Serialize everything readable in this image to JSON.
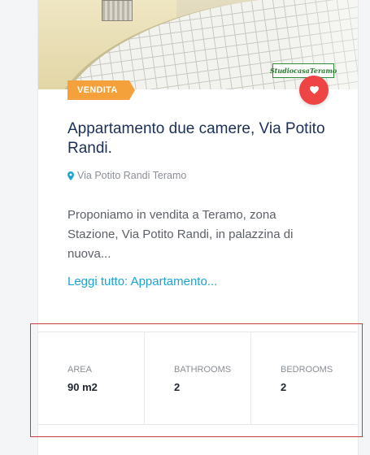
{
  "listing": {
    "status_badge": "VENDITA",
    "watermark_text": "StudiocasaTeramo",
    "title": "Appartamento due camere, Via Potito Randi.",
    "address": "Via Potito Randi Teramo",
    "description": "Proponiamo in vendita a Teramo, zona Stazione, Via Potito Randi, in palazzina di nuova...",
    "read_more": "Leggi tutto: Appartamento...",
    "favorite_icon": "heart-icon",
    "address_icon": "map-pin-icon"
  },
  "stats": [
    {
      "label": "AREA",
      "value": "90 m2"
    },
    {
      "label": "BATHROOMS",
      "value": "2"
    },
    {
      "label": "BEDROOMS",
      "value": "2"
    }
  ],
  "colors": {
    "badge": "#f5a13b",
    "favorite": "#ef4444",
    "title": "#1b2f57",
    "link": "#1aa3d6",
    "focus_outline": "#cc3b3b"
  }
}
